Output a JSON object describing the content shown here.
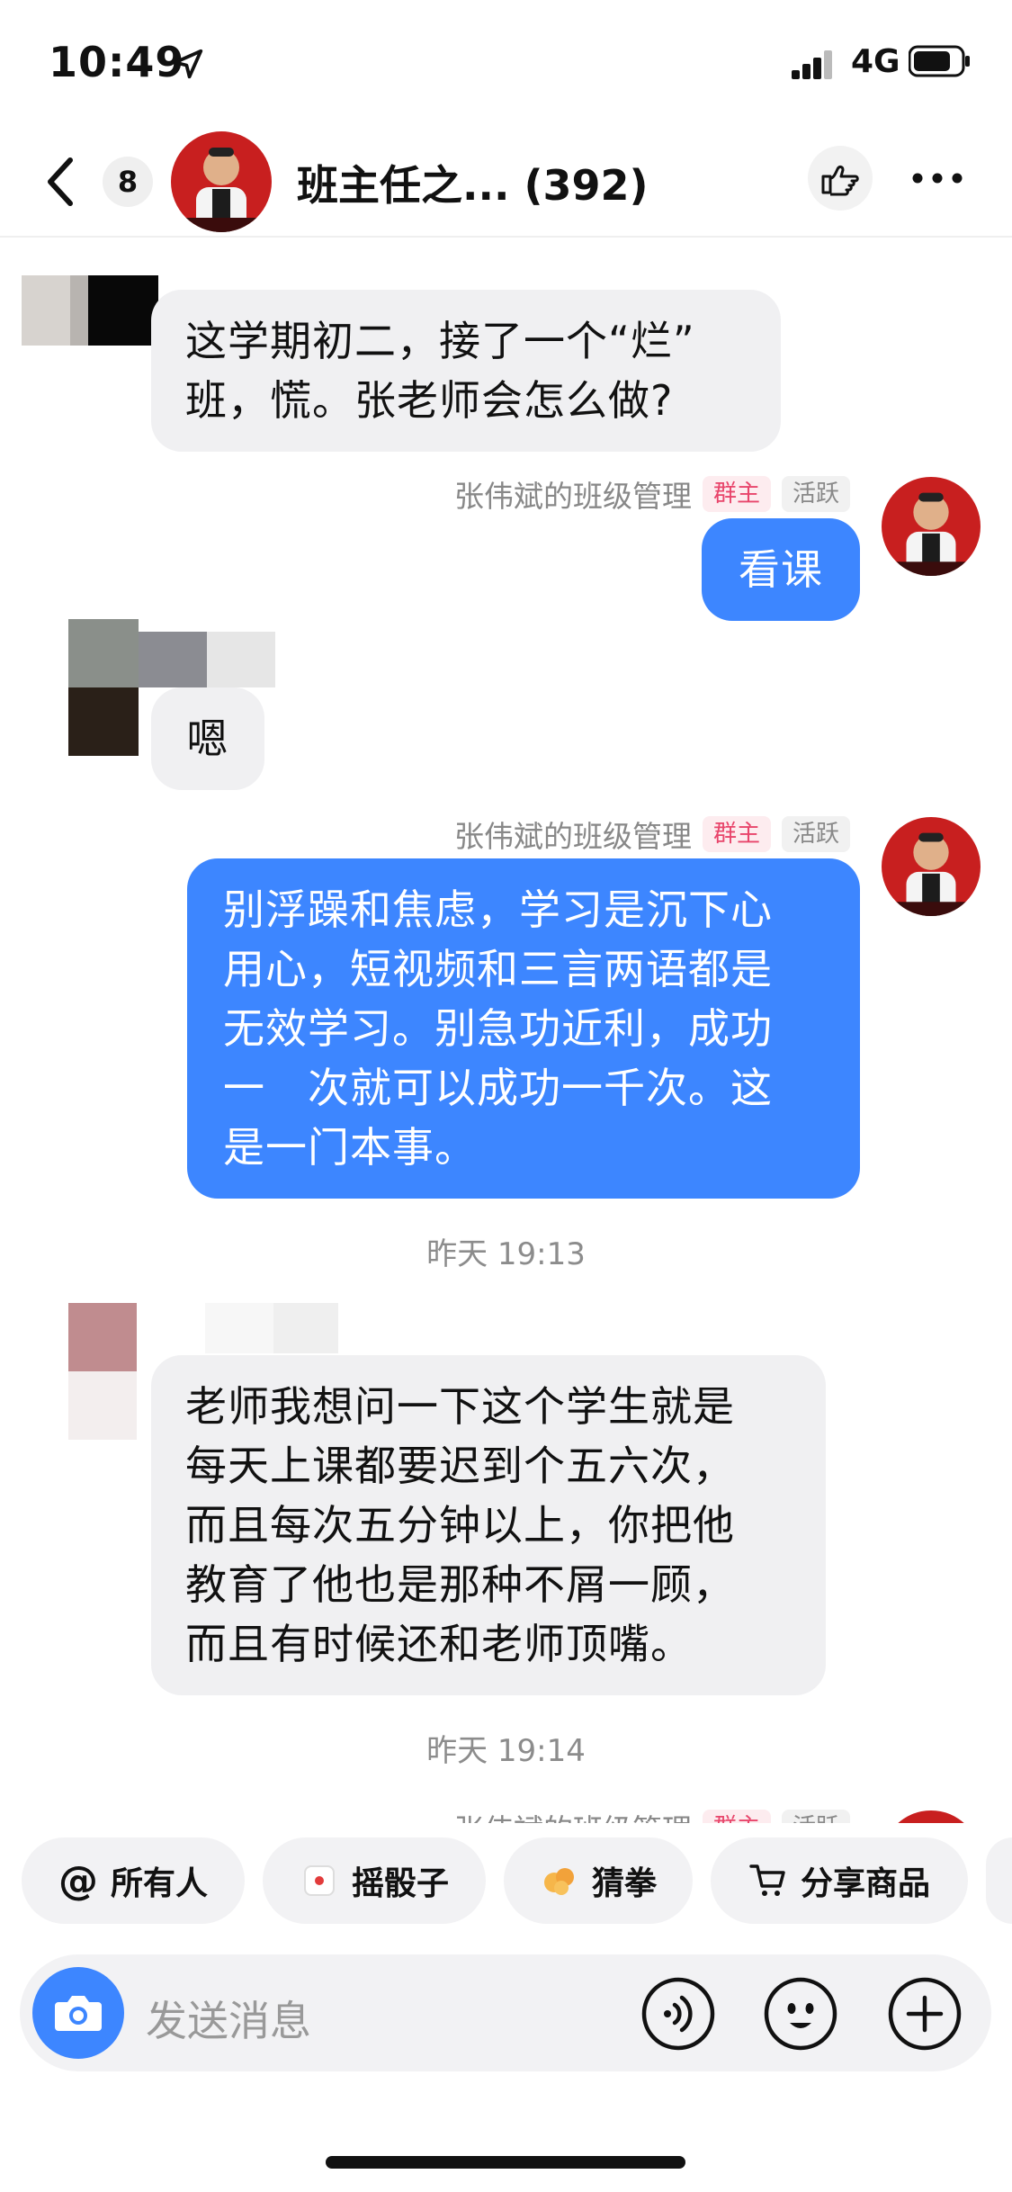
{
  "status_bar": {
    "time": "10:49",
    "network": "4G"
  },
  "header": {
    "unread_count": "8",
    "title": "班主任之... (392)"
  },
  "messages": [
    {
      "text": "这学期初二，接了一个“烂”\n班，慌。张老师会怎么做?"
    },
    {
      "sender": "张伟斌的班级管理",
      "tag_owner": "群主",
      "tag_active": "活跃",
      "text": "看课"
    },
    {
      "text": "嗯"
    },
    {
      "sender": "张伟斌的班级管理",
      "tag_owner": "群主",
      "tag_active": "活跃",
      "text": "别浮躁和焦虑，学习是沉下心\n用心，短视频和三言两语都是\n无效学习。别急功近利，成功\n一　次就可以成功一千次。这\n是一门本事。"
    },
    {
      "text": "老师我想问一下这个学生就是\n每天上课都要迟到个五六次，\n而且每次五分钟以上，你把他\n教育了他也是那种不屑一顾，\n而且有时候还和老师顶嘴。"
    }
  ],
  "timestamps": [
    "昨天 19:13",
    "昨天 19:14"
  ],
  "partial_sender": {
    "name": "张伟斌的班级管理",
    "tag_owner": "群主",
    "tag_active": "活跃"
  },
  "quick_actions": [
    {
      "label": "所有人",
      "icon": "at-icon"
    },
    {
      "label": "摇骰子",
      "icon": "dice-icon"
    },
    {
      "label": "猜拳",
      "icon": "hand-icon"
    },
    {
      "label": "分享商品",
      "icon": "cart-icon"
    }
  ],
  "input": {
    "placeholder": "发送消息"
  },
  "colors": {
    "accent": "#3d86ff",
    "owner_tag": "#e8456b"
  }
}
